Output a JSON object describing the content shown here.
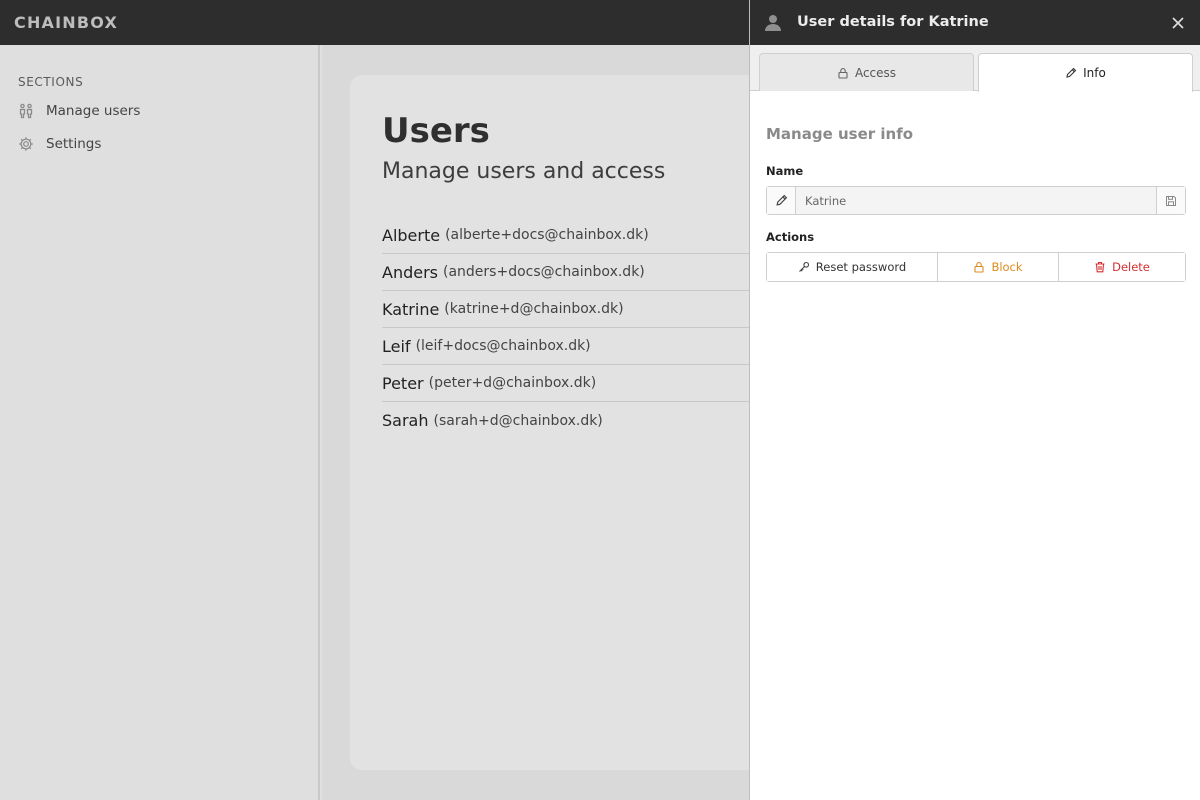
{
  "app": {
    "brand": "CHAINBOX"
  },
  "sidebar": {
    "heading": "SECTIONS",
    "items": [
      {
        "label": "Manage users",
        "icon": "users-icon"
      },
      {
        "label": "Settings",
        "icon": "gear-icon"
      }
    ]
  },
  "main": {
    "title": "Users",
    "subtitle": "Manage users and access",
    "users": [
      {
        "name": "Alberte",
        "email": "(alberte+docs@chainbox.dk)"
      },
      {
        "name": "Anders",
        "email": "(anders+docs@chainbox.dk)"
      },
      {
        "name": "Katrine",
        "email": "(katrine+d@chainbox.dk)"
      },
      {
        "name": "Leif",
        "email": "(leif+docs@chainbox.dk)"
      },
      {
        "name": "Peter",
        "email": "(peter+d@chainbox.dk)"
      },
      {
        "name": "Sarah",
        "email": "(sarah+d@chainbox.dk)"
      }
    ]
  },
  "drawer": {
    "title": "User details for Katrine",
    "tabs": [
      {
        "label": "Access",
        "icon": "lock-icon",
        "active": false
      },
      {
        "label": "Info",
        "icon": "pencil-icon",
        "active": true
      }
    ],
    "section_title": "Manage user info",
    "name_label": "Name",
    "name_value": "Katrine",
    "actions_label": "Actions",
    "actions": {
      "reset": "Reset password",
      "block": "Block",
      "delete": "Delete"
    }
  },
  "colors": {
    "topbar": "#2d2d2d",
    "block": "#e08a1e",
    "delete": "#d32f2f"
  }
}
